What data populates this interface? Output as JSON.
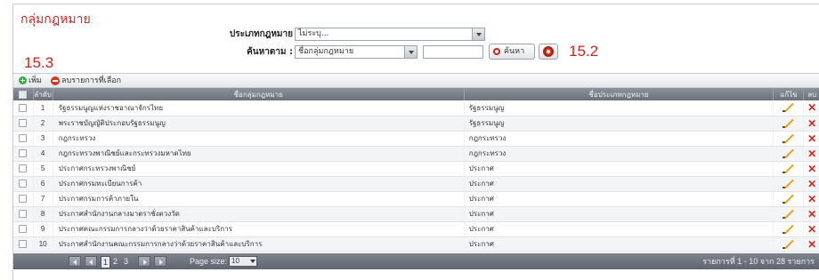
{
  "page": {
    "title": "กลุ่มกฎหมาย"
  },
  "filters": {
    "type_label": "ประเภทกฎหมาย",
    "type_value": "ไม่ระบุ...",
    "search_label": "ค้นหาตาม :",
    "search_field_value": "ชื่อกลุ่มกฎหมาย",
    "search_text_value": "",
    "search_button": "ค้นหา"
  },
  "annotations": {
    "left": "15.3",
    "right": "15.2"
  },
  "toolbar": {
    "add_label": "เพิ่ม",
    "delete_selected_label": "ลบรายการที่เลือก"
  },
  "grid": {
    "columns": {
      "no": "ลำดับ",
      "name": "ชื่อกลุ่มกฎหมาย",
      "type": "ชื่อประเภทกฎหมาย",
      "edit": "แก้ไข",
      "delete": "ลบ"
    },
    "rows": [
      {
        "no": "1",
        "name": "รัฐธรรมนูญแห่งราชอาณาจักรไทย",
        "type": "รัฐธรรมนูญ"
      },
      {
        "no": "2",
        "name": "พระราชบัญญัติประกอบรัฐธรรมนูญ",
        "type": "รัฐธรรมนูญ"
      },
      {
        "no": "3",
        "name": "กฎกระทรวง",
        "type": "กฎกระทรวง"
      },
      {
        "no": "4",
        "name": "กฎกระทรวงพาณิชย์และกระทรวงมหาดไทย",
        "type": "กฎกระทรวง"
      },
      {
        "no": "5",
        "name": "ประกาศกระทรวงพาณิชย์",
        "type": "ประกาศ"
      },
      {
        "no": "6",
        "name": "ประกาศกรมทะเบียนการค้า",
        "type": "ประกาศ"
      },
      {
        "no": "7",
        "name": "ประกาศกรมการค้าภายใน",
        "type": "ประกาศ"
      },
      {
        "no": "8",
        "name": "ประกาศสำนักงานกลางมาตราชั่งตวงวัด",
        "type": "ประกาศ"
      },
      {
        "no": "9",
        "name": "ประกาศคณะกรรมการกลางว่าด้วยราคาสินค้าและบริการ",
        "type": "ประกาศ"
      },
      {
        "no": "10",
        "name": "ประกาศสำนักงานคณะกรรมการกลางว่าด้วยราคาสินค้าและบริการ",
        "type": "ประกาศ"
      }
    ]
  },
  "pager": {
    "pages": [
      "1",
      "2",
      "3"
    ],
    "current_page": "1",
    "page_size_label": "Page size:",
    "page_size_value": "10",
    "info": "รายการที่ 1 - 10 จาก 28 รายการ"
  }
}
